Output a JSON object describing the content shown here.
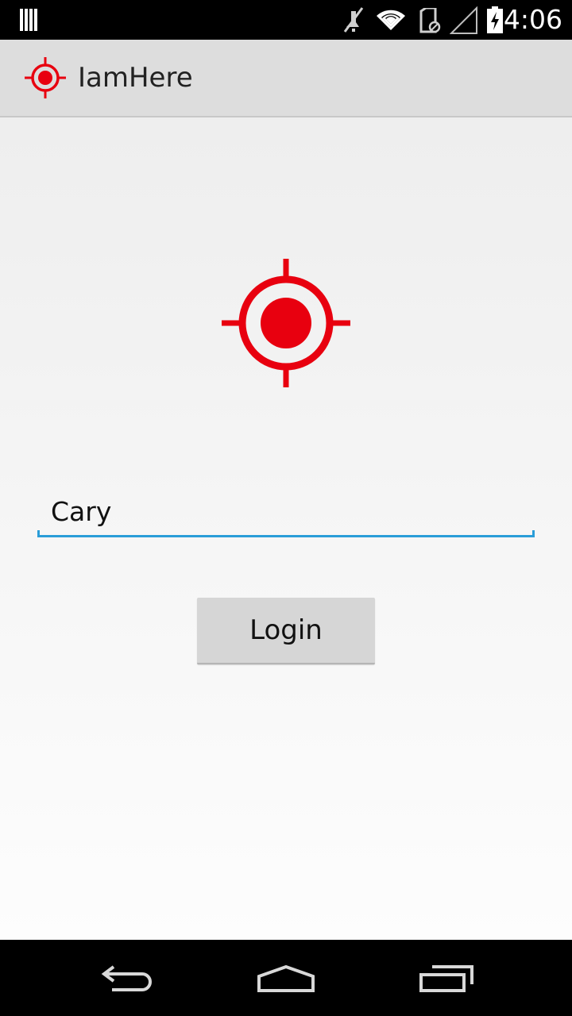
{
  "status_bar": {
    "time": "4:06",
    "icons": [
      "sim-icon",
      "mute-icon",
      "wifi-icon",
      "sd-card-icon",
      "signal-icon",
      "battery-charging-icon"
    ]
  },
  "action_bar": {
    "app_title": "IamHere",
    "app_icon": "target-icon"
  },
  "login_form": {
    "logo_icon": "target-icon",
    "name_value": "Cary",
    "login_label": "Login"
  },
  "nav_bar": {
    "icons": [
      "back-icon",
      "home-icon",
      "recents-icon"
    ]
  },
  "colors": {
    "accent": "#e8000f",
    "field_underline": "#2a9dd8",
    "action_bar_bg": "#dddddd",
    "button_bg": "#d6d6d6"
  }
}
